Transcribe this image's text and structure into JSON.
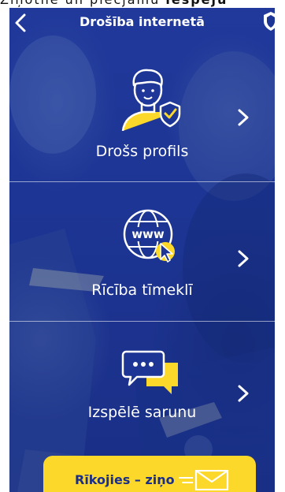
{
  "caption": {
    "part1": "Ziņotne un piecjamu ",
    "part2": "iespēju"
  },
  "header": {
    "title": "Drošība internetā"
  },
  "menu": {
    "items": [
      {
        "label": "Drošs profils",
        "icon": "profile-shield-icon"
      },
      {
        "label": "Rīcība tīmeklī",
        "icon": "www-globe-cursor-icon"
      },
      {
        "label": "Izspēlē sarunu",
        "icon": "chat-bubbles-icon"
      }
    ]
  },
  "cta": {
    "label": "Rīkojies – ziņo",
    "icon": "envelope-icon"
  },
  "colors": {
    "background_blue": "#1d3594",
    "accent_yellow": "#fcd82a",
    "text_white": "#ffffff"
  }
}
